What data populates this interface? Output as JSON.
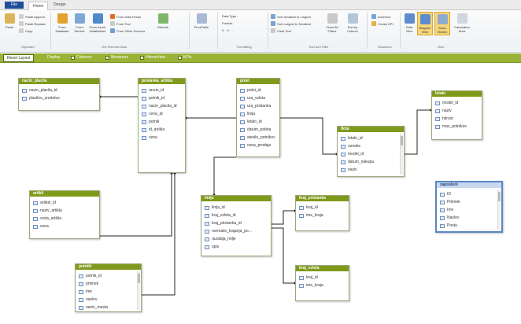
{
  "ribbon_tabs": {
    "file": "File",
    "tabs": [
      "Home",
      "Design"
    ]
  },
  "ribbon": {
    "paste": "Paste",
    "paste_append": "Paste Append",
    "paste_replace": "Paste Replace",
    "copy": "Copy",
    "from_database": "From Database",
    "from_service": "From Service",
    "from_azure": "From Azure DataMarket",
    "from_data_feeds": "From Data Feeds",
    "from_text": "From Text",
    "from_other": "From Other Sources",
    "refresh": "Refresh",
    "pivottable": "PivotTable",
    "data_type": "Data Type :",
    "format": "Format :",
    "sort_s2l": "Sort Smallest to Largest",
    "sort_l2s": "Sort Largest to Smallest",
    "clear_sort": "Clear Sort",
    "clear_all_filters": "Clear All Filters",
    "sort_by_column": "Sort by Column",
    "autosum": "AutoSum",
    "create_kpi": "Create KPI",
    "data_view": "Data View",
    "diagram_view": "Diagram View",
    "show_hidden": "Show Hidden",
    "calculation_area": "Calculation Area",
    "groups": [
      "Clipboard",
      "Get External Data",
      "Formatting",
      "Sort and Filter",
      "Measures",
      "View"
    ]
  },
  "toolbar": {
    "reset_layout": "Reset Layout",
    "display": "Display",
    "options": [
      "Columns",
      "Measures",
      "Hierarchies",
      "KPIs"
    ]
  },
  "tables": {
    "nacin_placila": {
      "name": "nacin_placila",
      "columns": [
        "nacin_placila_id",
        "placilno_sredstvo"
      ]
    },
    "postavka": {
      "name": "postavka_artikla",
      "columns": [
        "racun_id",
        "potnik_id",
        "nacin_placila_id",
        "cena_id",
        "potnik",
        "id_artikla",
        "cena"
      ]
    },
    "polet": {
      "name": "polet",
      "columns": [
        "polet_id",
        "ura_vzleta",
        "ura_pristanka",
        "linija",
        "letalo_id",
        "datum_poleta",
        "stevilo_potnikov",
        "cena_prodaje"
      ]
    },
    "letalo": {
      "name": "letalo",
      "columns": [
        "model_id",
        "naziv",
        "hitrost",
        "max_potnikov"
      ]
    },
    "flota": {
      "name": "flota",
      "columns": [
        "letalo_id",
        "oznake",
        "model_id",
        "datum_nakupa",
        "naziv"
      ]
    },
    "artikli": {
      "name": "artikli",
      "columns": [
        "artikel_id",
        "naziv_artikla",
        "vrsta_artikla",
        "cena"
      ]
    },
    "linija": {
      "name": "linija",
      "columns": [
        "linija_id",
        "kraj_vzleta_id",
        "kraj_pristanka_id",
        "normativ_trajanja_po...",
        "razdalja_milje",
        "opis"
      ]
    },
    "kraj_pristanka": {
      "name": "kraj_pristanka",
      "columns": [
        "kraj_id",
        "ime_kraja"
      ]
    },
    "zaposleni": {
      "name": "zaposleni",
      "columns": [
        "ID",
        "Priimek",
        "Ime",
        "Naslov",
        "Posta"
      ]
    },
    "potniki": {
      "name": "potniki",
      "columns": [
        "potnik_id",
        "priimek",
        "ime",
        "naslov",
        "naziv_mesta"
      ]
    },
    "kraj_vzleta": {
      "name": "kraj_vzleta",
      "columns": [
        "kraj_id",
        "ime_kraja"
      ]
    }
  },
  "colors": {
    "table_header": "#7f9a1a",
    "toolbar": "#9ab236",
    "relationship": "#222222",
    "selected_border": "#5a86c9"
  }
}
